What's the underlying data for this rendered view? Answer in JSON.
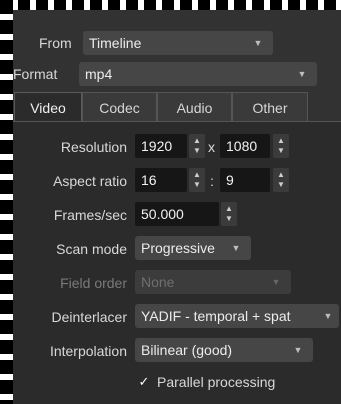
{
  "top": {
    "from_label": "From",
    "from_value": "Timeline",
    "format_label": "Format",
    "format_value": "mp4"
  },
  "tabs": [
    "Video",
    "Codec",
    "Audio",
    "Other"
  ],
  "active_tab": "Video",
  "video": {
    "resolution_label": "Resolution",
    "resolution_width": "1920",
    "resolution_x": "x",
    "resolution_height": "1080",
    "aspect_label": "Aspect ratio",
    "aspect_num": "16",
    "aspect_sep": ":",
    "aspect_den": "9",
    "fps_label": "Frames/sec",
    "fps_value": "50.000",
    "scan_label": "Scan mode",
    "scan_value": "Progressive",
    "field_label": "Field order",
    "field_value": "None",
    "deint_label": "Deinterlacer",
    "deint_value": "YADIF - temporal + spat",
    "interp_label": "Interpolation",
    "interp_value": "Bilinear (good)",
    "parallel_label": "Parallel processing",
    "parallel_checked": true
  }
}
